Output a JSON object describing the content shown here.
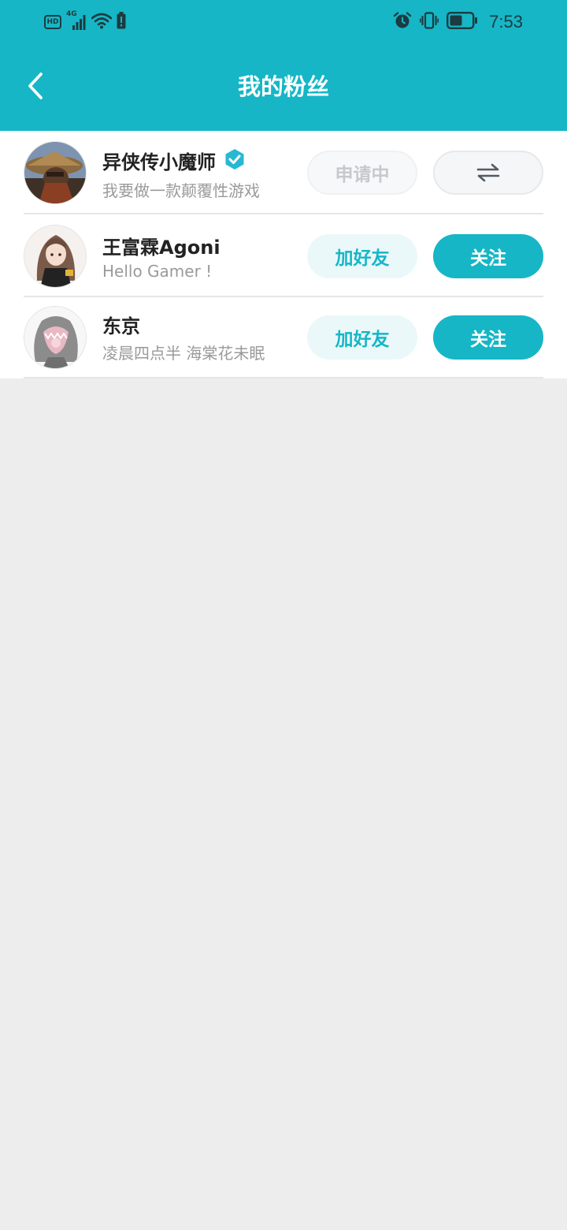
{
  "status_bar": {
    "hd": "HD",
    "network": "4G",
    "time": "7:53"
  },
  "nav": {
    "title": "我的粉丝"
  },
  "colors": {
    "accent": "#16b6c6",
    "background": "#ededed",
    "verified": "#27b9d4"
  },
  "fans": [
    {
      "name": "异侠传小魔师",
      "bio": "我要做一款颠覆性游戏",
      "verified": true,
      "primary_action": "申请中",
      "secondary_icon": "swap-arrows-icon"
    },
    {
      "name": "王富霖Agoni",
      "bio": "Hello Gamer !",
      "verified": false,
      "primary_action": "加好友",
      "secondary_action": "关注"
    },
    {
      "name": "东京",
      "bio": "凌晨四点半 海棠花未眠",
      "verified": false,
      "primary_action": "加好友",
      "secondary_action": "关注"
    }
  ]
}
